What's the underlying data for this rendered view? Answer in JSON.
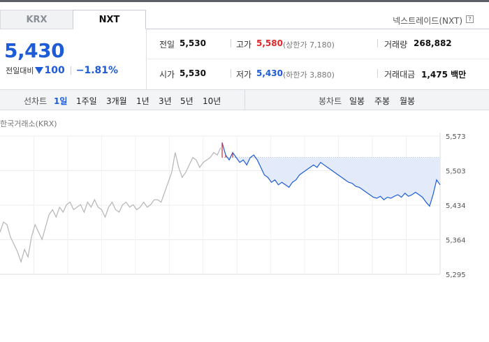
{
  "tabs": {
    "krx": "KRX",
    "nxt": "NXT"
  },
  "market_label": "넥스트레이드(NXT)",
  "help_icon_text": "?",
  "price": {
    "current": "5,430",
    "change_label": "전일대비",
    "change_value": "100",
    "change_percent": "−1.81%"
  },
  "info": {
    "prev_close_label": "전일",
    "prev_close": "5,530",
    "open_label": "시가",
    "open": "5,530",
    "high_label": "고가",
    "high": "5,580",
    "upper_limit": "(상한가 7,180)",
    "low_label": "저가",
    "low": "5,430",
    "lower_limit": "(하한가 3,880)",
    "volume_label": "거래량",
    "volume": "268,882",
    "amount_label": "거래대금",
    "amount": "1,475 백만"
  },
  "period_bar": {
    "line_label": "선차트",
    "line_options": [
      "1일",
      "1주일",
      "3개월",
      "1년",
      "3년",
      "5년",
      "10년"
    ],
    "active": "1일",
    "candle_label": "봉차트",
    "candle_options": [
      "일봉",
      "주봉",
      "월봉"
    ]
  },
  "chart_title": "한국거래소(KRX)",
  "colors": {
    "accent": "#1e5bd6",
    "up": "#e0262a",
    "krx_line": "#b5b5b5",
    "fill": "#e3ebfa"
  },
  "chart_data": {
    "type": "line",
    "title": "",
    "y_ticks": [
      "5,573",
      "5,503",
      "5,434",
      "5,364",
      "5,295"
    ],
    "ylim": [
      5295,
      5573
    ],
    "reference_line": 5530,
    "series": [
      {
        "values": [
          5380,
          5400,
          5395,
          5370,
          5355,
          5340,
          5320,
          5345,
          5330,
          5370,
          5395,
          5380,
          5365,
          5390,
          5415,
          5425,
          5410,
          5430,
          5420,
          5435,
          5440,
          5425,
          5430,
          5435,
          5420,
          5440,
          5430,
          5445,
          5430,
          5425,
          5410,
          5430,
          5440,
          5425,
          5420,
          5435,
          5440,
          5430,
          5435,
          5425,
          5430,
          5440,
          5430,
          5435,
          5445,
          5445,
          5440,
          5460,
          5480,
          5500,
          5540,
          5510,
          5490,
          5500,
          5515,
          5530,
          5525,
          5510,
          5520,
          5525,
          5530,
          5540,
          5535,
          5550
        ]
      },
      {
        "values": [
          5560,
          5535,
          5525,
          5540,
          5530,
          5520,
          5525,
          5515,
          5530,
          5535,
          5525,
          5510,
          5495,
          5490,
          5480,
          5485,
          5475,
          5480,
          5475,
          5470,
          5480,
          5485,
          5495,
          5500,
          5505,
          5510,
          5515,
          5510,
          5520,
          5515,
          5510,
          5505,
          5500,
          5495,
          5490,
          5485,
          5480,
          5478,
          5472,
          5470,
          5465,
          5460,
          5455,
          5450,
          5448,
          5452,
          5445,
          5450,
          5448,
          5452,
          5455,
          5450,
          5458,
          5452,
          5455,
          5460,
          5455,
          5450,
          5440,
          5432,
          5455,
          5485,
          5475
        ]
      }
    ]
  }
}
